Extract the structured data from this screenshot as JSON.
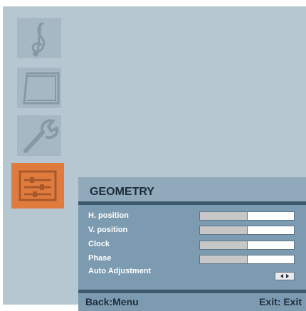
{
  "menu": {
    "items": [
      {
        "icon": "treble-clef-icon",
        "active": false
      },
      {
        "icon": "monitor-icon",
        "active": false
      },
      {
        "icon": "wrench-icon",
        "active": false
      },
      {
        "icon": "geometry-sliders-icon",
        "active": true
      }
    ]
  },
  "geometry": {
    "title": "GEOMETRY",
    "rows": [
      {
        "label": "H. position",
        "value": 0.51
      },
      {
        "label": "V. position",
        "value": 0.51
      },
      {
        "label": "Clock",
        "value": 0.51
      },
      {
        "label": "Phase",
        "value": 0.51
      }
    ],
    "auto_adjustment": {
      "label": "Auto Adjustment"
    }
  },
  "footer": {
    "back": "Back:Menu",
    "exit": "Exit: Exit"
  },
  "colors": {
    "background": "#b7c7d2",
    "panel": "#7d9bb0",
    "active_icon": "#e07b3e",
    "inactive_icon": "#a6b8c4",
    "text_dark": "#1d2d3a"
  }
}
